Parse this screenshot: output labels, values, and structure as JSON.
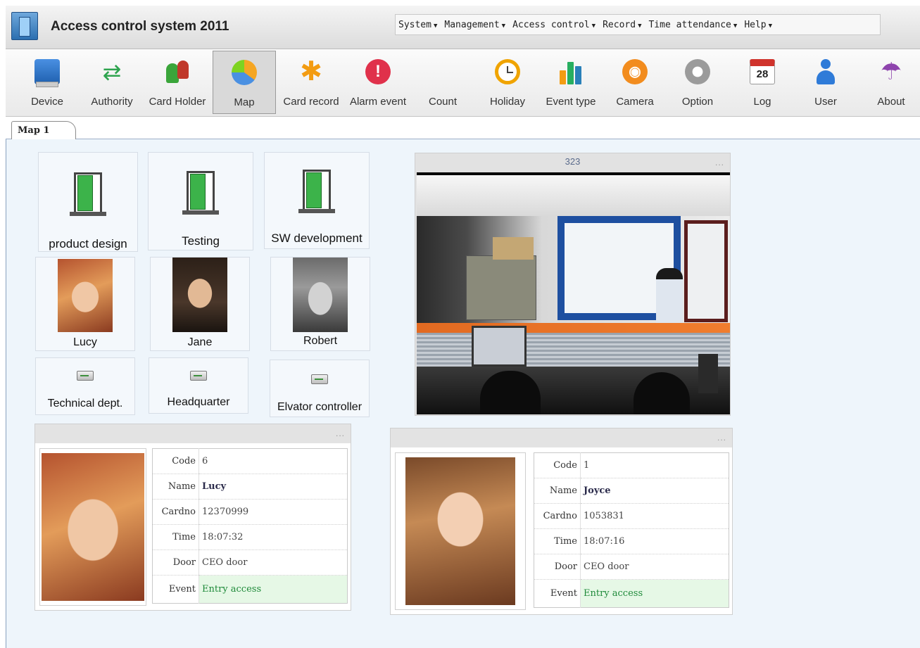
{
  "app": {
    "title": "Access control system 2011"
  },
  "menu": [
    {
      "label": "System",
      "caret": "▼"
    },
    {
      "label": "Management",
      "caret": "▼"
    },
    {
      "label": "Access control",
      "caret": "▼"
    },
    {
      "label": "Record",
      "caret": "▼"
    },
    {
      "label": "Time attendance",
      "caret": "▼"
    },
    {
      "label": "Help",
      "caret": "▼"
    }
  ],
  "toolbar": [
    {
      "label": "Device",
      "icon": "device-icon"
    },
    {
      "label": "Authority",
      "icon": "sync-icon",
      "glyph": "⇄"
    },
    {
      "label": "Card Holder",
      "icon": "users-icon"
    },
    {
      "label": "Map",
      "icon": "pie-chart-icon",
      "active": true
    },
    {
      "label": "Card record",
      "icon": "asterisk-icon",
      "glyph": "✱"
    },
    {
      "label": "Alarm event",
      "icon": "alarm-icon",
      "glyph": "!"
    },
    {
      "label": "Count",
      "icon": "count-icon"
    },
    {
      "label": "Holiday",
      "icon": "clock-icon"
    },
    {
      "label": "Event type",
      "icon": "bar-chart-icon"
    },
    {
      "label": "Camera",
      "icon": "rss-icon",
      "glyph": "◉"
    },
    {
      "label": "Option",
      "icon": "gear-icon"
    },
    {
      "label": "Log",
      "icon": "calendar-icon",
      "glyph": "28"
    },
    {
      "label": "User",
      "icon": "user-icon"
    },
    {
      "label": "About",
      "icon": "umbrella-icon",
      "glyph": "☂"
    }
  ],
  "tabs": [
    {
      "label": "Map 1"
    }
  ],
  "doors": [
    {
      "label": "product design"
    },
    {
      "label": "Testing"
    },
    {
      "label": "SW development"
    }
  ],
  "people": [
    {
      "label": "Lucy"
    },
    {
      "label": "Jane"
    },
    {
      "label": "Robert"
    }
  ],
  "controllers": [
    {
      "label": "Technical dept."
    },
    {
      "label": "Headquarter"
    },
    {
      "label": "Elvator controller"
    }
  ],
  "camera": {
    "title": "323",
    "menu": "..."
  },
  "cards": [
    {
      "menu": "...",
      "rows": [
        {
          "key": "Code",
          "value": "6"
        },
        {
          "key": "Name",
          "value": "Lucy"
        },
        {
          "key": "Cardno",
          "value": "12370999"
        },
        {
          "key": "Time",
          "value": "18:07:32"
        },
        {
          "key": "Door",
          "value": "CEO door"
        },
        {
          "key": "Event",
          "value": "Entry access"
        }
      ]
    },
    {
      "menu": "...",
      "rows": [
        {
          "key": "Code",
          "value": "1"
        },
        {
          "key": "Name",
          "value": "Joyce"
        },
        {
          "key": "Cardno",
          "value": "1053831"
        },
        {
          "key": "Time",
          "value": "18:07:16"
        },
        {
          "key": "Door",
          "value": "CEO door"
        },
        {
          "key": "Event",
          "value": "Entry access"
        }
      ]
    }
  ],
  "colors": {
    "door_green": "#3cb34a",
    "event_green": "#1f8a3a",
    "accent_blue": "#1e4fa0"
  }
}
